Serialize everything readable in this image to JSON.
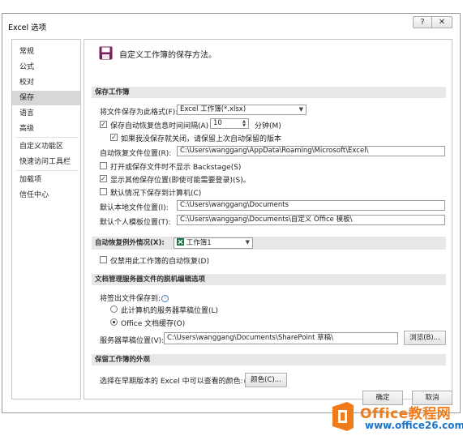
{
  "window": {
    "title": "Excel 选项",
    "help_glyph": "?",
    "close_glyph": "✕"
  },
  "sidebar": {
    "items": [
      {
        "label": "常规"
      },
      {
        "label": "公式"
      },
      {
        "label": "校对"
      },
      {
        "label": "保存"
      },
      {
        "label": "语言"
      },
      {
        "label": "高级"
      },
      {
        "label": "自定义功能区"
      },
      {
        "label": "快速访问工具栏"
      },
      {
        "label": "加载项"
      },
      {
        "label": "信任中心"
      }
    ],
    "selected": "保存"
  },
  "header": {
    "text": "自定义工作簿的保存方法。"
  },
  "save_workbooks": {
    "section_title": "保存工作簿",
    "format_label": "将文件保存为此格式(F):",
    "format_value": "Excel 工作簿(*.xlsx)",
    "autorecover_label": "保存自动恢复信息时间间隔(A)",
    "autorecover_checked": true,
    "autorecover_minutes": "10",
    "minutes_label": "分钟(M)",
    "keep_last_label": "如果我没保存就关闭，请保留上次自动保留的版本",
    "keep_last_checked": true,
    "autorecover_location_label": "自动恢复文件位置(R):",
    "autorecover_location": "C:\\Users\\wanggang\\AppData\\Roaming\\Microsoft\\Excel\\",
    "no_backstage_label": "打开或保存文件时不显示 Backstage(S)",
    "no_backstage_checked": false,
    "show_additional_label": "显示其他保存位置(即使可能需要登录)(S)。",
    "show_additional_checked": true,
    "default_computer_label": "默认情况下保存到计算机(C)",
    "default_computer_checked": false,
    "local_location_label": "默认本地文件位置(I):",
    "local_location": "C:\\Users\\wanggang\\Documents",
    "template_location_label": "默认个人模板位置(T):",
    "template_location": "C:\\Users\\wanggang\\Documents\\自定义 Office 模板\\"
  },
  "autorecover_exceptions": {
    "section_title": "自动恢复例外情况(X):",
    "workbook_value": "工作簿1",
    "disable_label": "仅禁用此工作簿的自动恢复(D)",
    "disable_checked": false
  },
  "offline_editing": {
    "section_title": "文档管理服务器文件的脱机编辑选项",
    "checkout_label": "将签出文件保存到:",
    "option_drafts": "此计算机的服务器草稿位置(L)",
    "option_cache": "Office 文档缓存(O)",
    "selected_option": "Office 文档缓存(O)",
    "drafts_location_label": "服务器草稿位置(V):",
    "drafts_location": "C:\\Users\\wanggang\\Documents\\SharePoint 草稿\\",
    "browse_label": "浏览(B)..."
  },
  "preserve_visual": {
    "section_title": "保留工作簿的外观",
    "colors_label": "选择在早期版本的 Excel 中可以查看的颜色:",
    "colors_button": "颜色(C)..."
  },
  "footer": {
    "ok_label": "确定",
    "cancel_label": "取消"
  },
  "watermark": {
    "brand_text": "Office教程网",
    "url_text": "www.office26.com"
  },
  "colors": {
    "selected_nav": "#d7d7d7",
    "section_bg": "#e7e7e7",
    "excel_green": "#1e7145",
    "save_icon": "#7a1f5c",
    "watermark_orange": "#f07b1a",
    "watermark_blue": "#1a73c9"
  }
}
